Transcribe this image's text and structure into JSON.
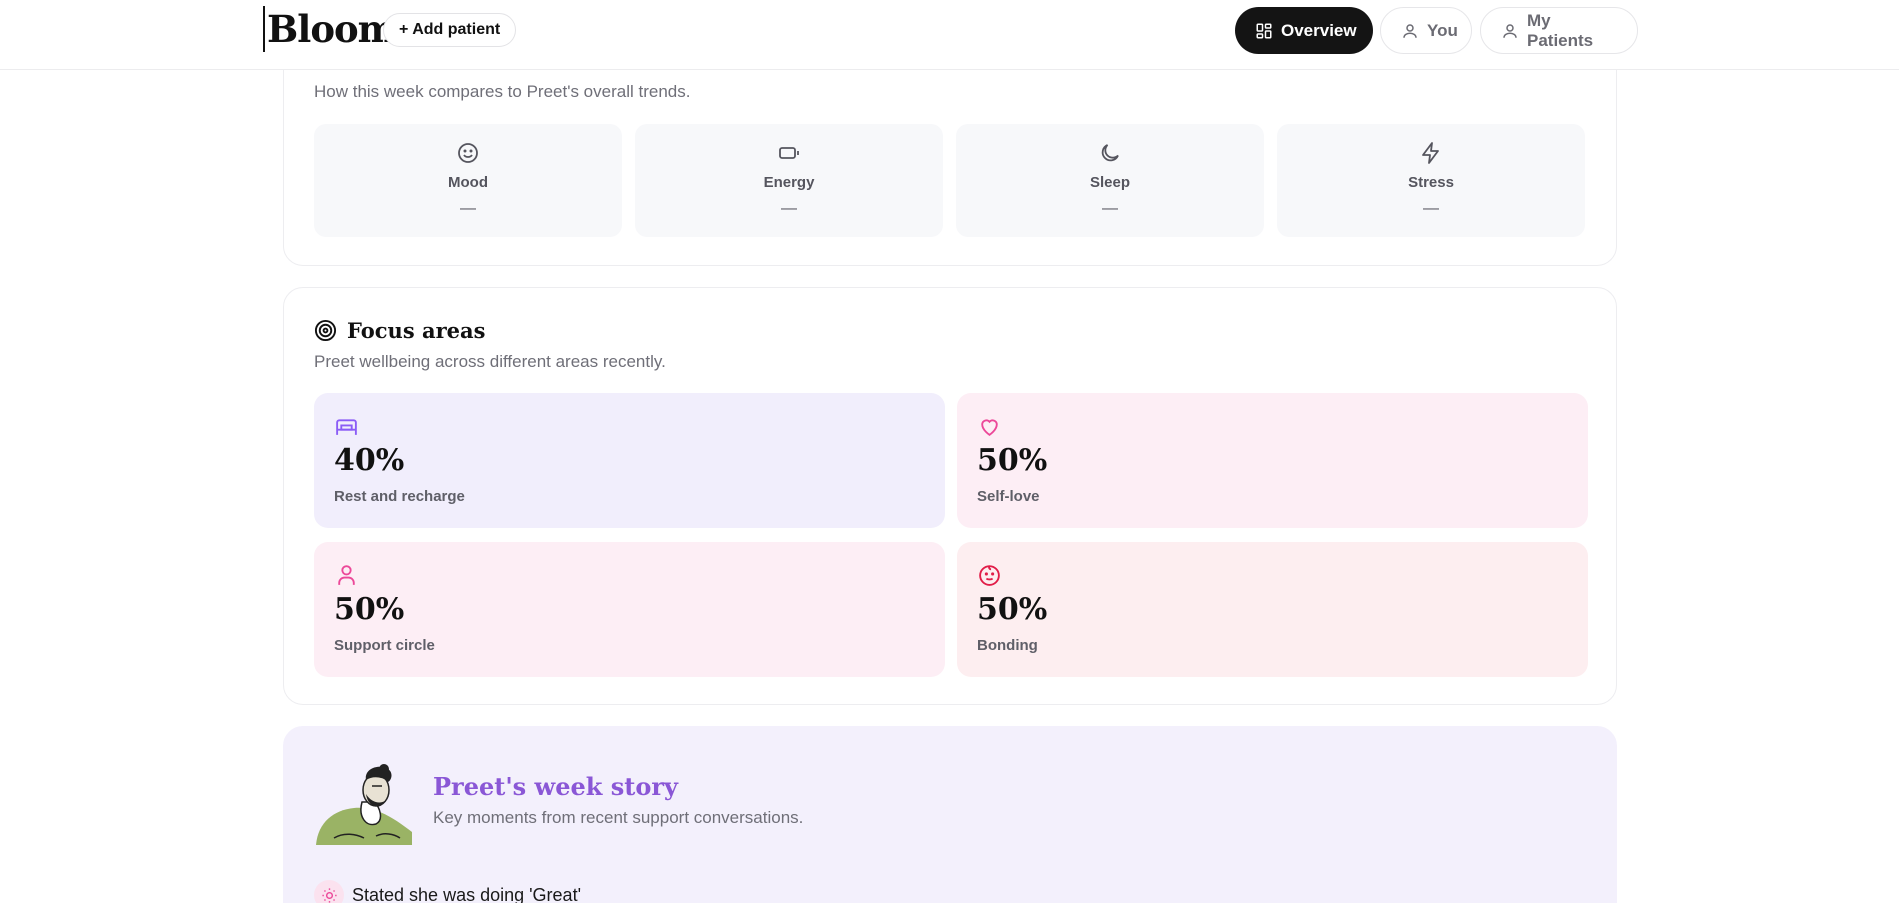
{
  "header": {
    "logo": "Bloom",
    "add_patient": "+ Add patient",
    "nav": {
      "overview": "Overview",
      "you": "You",
      "my_patients": "My Patients"
    }
  },
  "weekly": {
    "subtitle": "How this week compares to Preet's overall trends.",
    "metrics": [
      {
        "label": "Mood",
        "value": "—",
        "icon": "smile-icon"
      },
      {
        "label": "Energy",
        "value": "—",
        "icon": "battery-icon"
      },
      {
        "label": "Sleep",
        "value": "—",
        "icon": "moon-icon"
      },
      {
        "label": "Stress",
        "value": "—",
        "icon": "lightning-icon"
      }
    ]
  },
  "focus": {
    "title": "Focus areas",
    "subtitle": "Preet wellbeing across different areas recently.",
    "items": [
      {
        "value": "40%",
        "label": "Rest and recharge",
        "icon": "bed-icon"
      },
      {
        "value": "50%",
        "label": "Self-love",
        "icon": "heart-icon"
      },
      {
        "value": "50%",
        "label": "Support circle",
        "icon": "person-icon"
      },
      {
        "value": "50%",
        "label": "Bonding",
        "icon": "baby-icon"
      }
    ],
    "colors": {
      "rest": "#8b5cf6",
      "self_love": "#ec4899",
      "support": "#ec4899",
      "bonding": "#e11d48"
    }
  },
  "story": {
    "title": "Preet's week story",
    "subtitle": "Key moments from recent support conversations.",
    "moments": [
      {
        "text": "Stated she was doing 'Great'",
        "icon": "sun-icon"
      }
    ]
  }
}
